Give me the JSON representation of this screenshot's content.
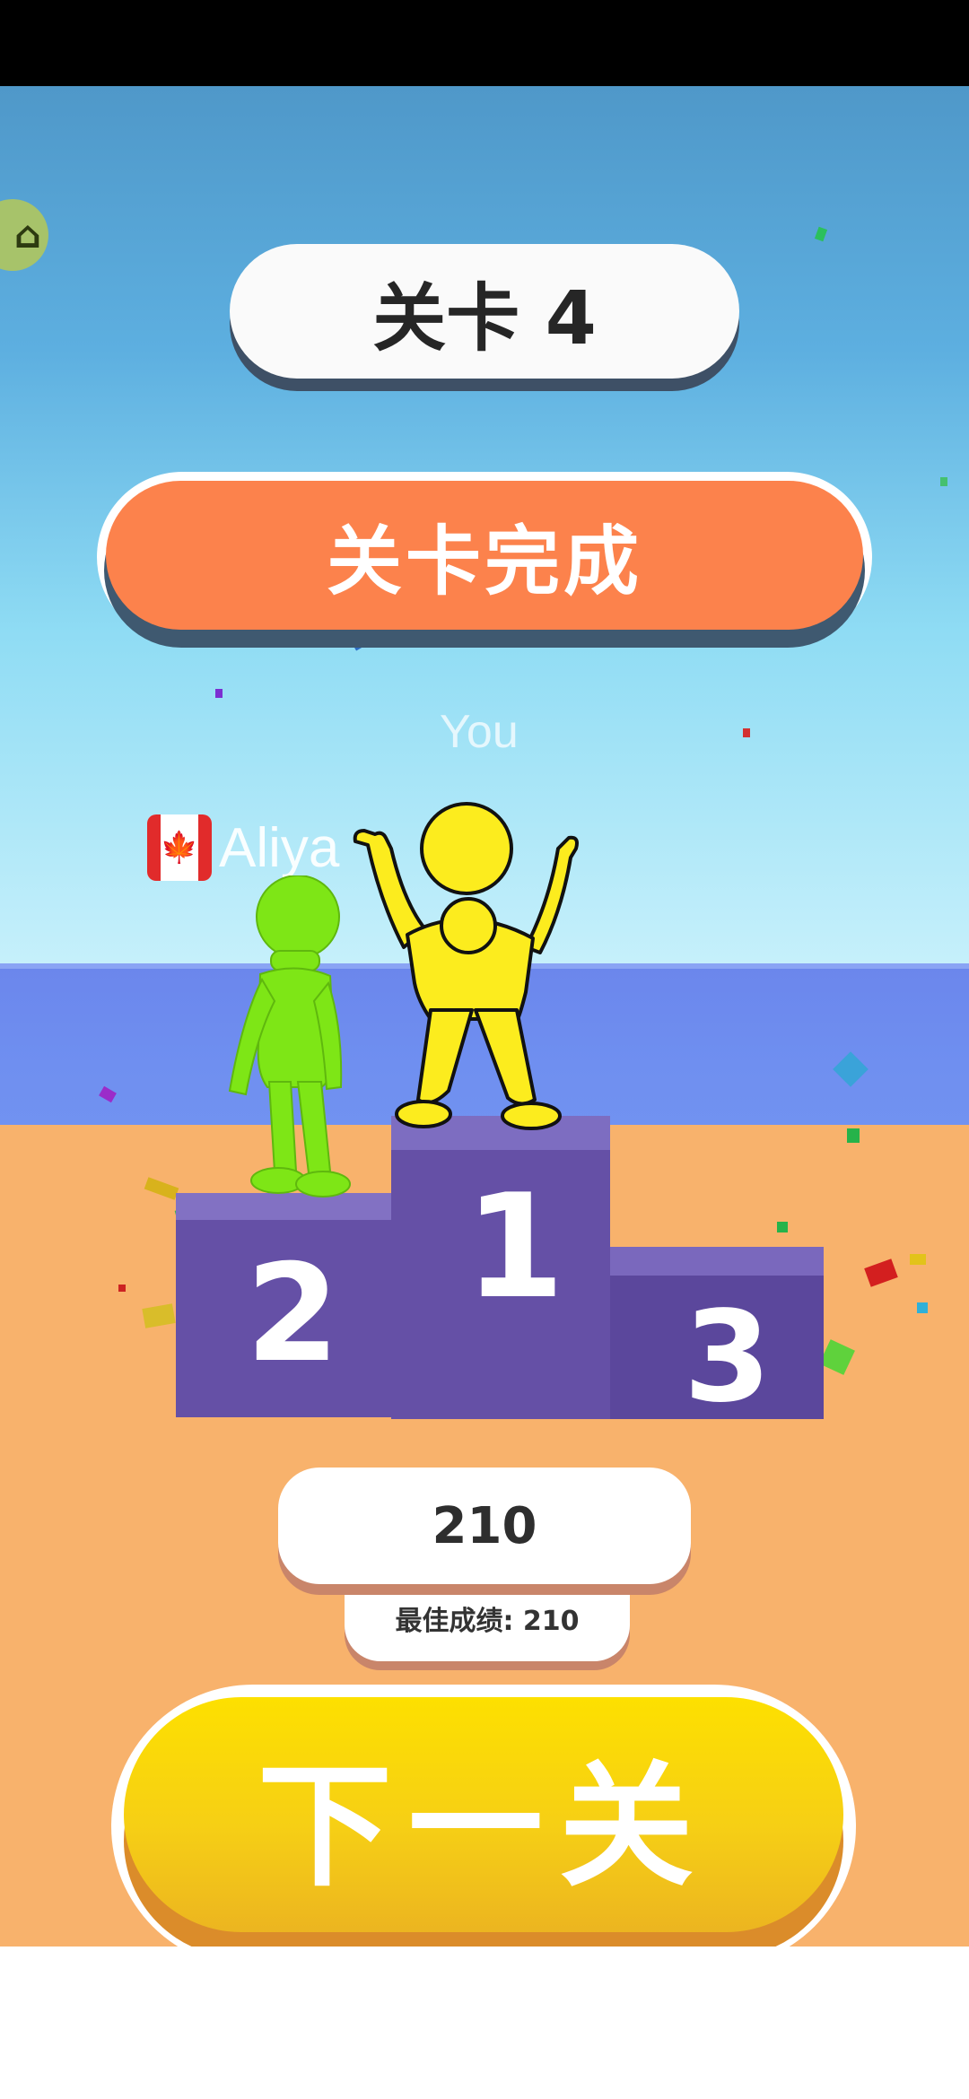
{
  "level": {
    "title": "关卡 4"
  },
  "banner": {
    "text": "关卡完成"
  },
  "players": {
    "you_label": "You",
    "opponent_name": "Aliya",
    "opponent_flag": "canada-flag"
  },
  "podium": {
    "first": "1",
    "second": "2",
    "third": "3"
  },
  "score": {
    "value": "210",
    "best": "最佳成绩: 210"
  },
  "next_button": {
    "label": "下一关"
  },
  "colors": {
    "banner_orange": "#fc824c",
    "podium_purple": "#6550a6",
    "next_yellow": "#f6cf15",
    "green_figure": "#7ee616",
    "yellow_figure": "#fcec1e"
  }
}
